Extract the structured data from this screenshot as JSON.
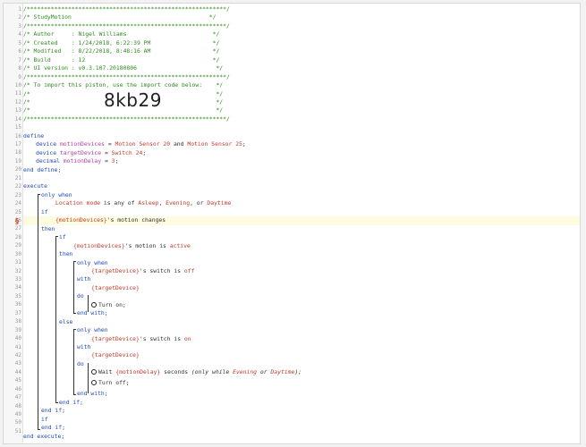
{
  "line_numbers": [
    "1",
    "2",
    "3",
    "4",
    "5",
    "6",
    "7",
    "8",
    "9",
    "10",
    "11",
    "12",
    "13",
    "14",
    "15",
    "16",
    "17",
    "18",
    "19",
    "20",
    "21",
    "22",
    "23",
    "24",
    "25",
    "26",
    "27",
    "28",
    "29",
    "30",
    "31",
    "32",
    "33",
    "34",
    "35",
    "36",
    "37",
    "38",
    "39",
    "40",
    "41",
    "42",
    "43",
    "44",
    "45",
    "46",
    "47",
    "48",
    "49",
    "50",
    "51"
  ],
  "header": {
    "border": "/**********************************************************/",
    "title": "/* StudyMotion                                        */",
    "author": "/* Author     : Nigel Williams                         */",
    "created": "/* Created    : 1/24/2018, 6:22:39 PM                  */",
    "modified": "/* Modified   : 8/22/2018, 8:48:16 AM                  */",
    "build": "/* Build      : 12                                     */",
    "ui_version": "/* UI version : v0.3.107.20180806                       */",
    "import_hint": "/* To import this piston, use the import code below:    */",
    "blank": "/*                                                      */",
    "import_code": "8kb29"
  },
  "code": {
    "define": "define",
    "device_kw": "device",
    "decimal_kw": "decimal",
    "motion_devices": "motionDevices",
    "target_device": "targetDevice",
    "motion_delay": "motionDelay",
    "eq": " = ",
    "sensor20": "Motion Sensor 20",
    "and": " and ",
    "sensor25": "Motion Sensor 25",
    "semicolon": ";",
    "switch24": "Switch 24",
    "three": "3",
    "end_define": "end define;",
    "execute": "execute",
    "only_when": "only when",
    "location_mode": "Location mode",
    "is_any_of": " is any of ",
    "asleep": "Asleep",
    "comma": ", ",
    "evening": "Evening",
    "or_word": ", or ",
    "daytime": "Daytime",
    "if_kw": "if",
    "motion_devices_ref": "{motionDevices}",
    "motion_changes": "'s motion changes",
    "then_kw": "then",
    "motion_is": "'s motion is ",
    "active": "active",
    "target_device_ref": "{targetDevice}",
    "switch_is": "'s switch is ",
    "off": "off",
    "on": "on",
    "with_kw": "with",
    "do_kw": "do",
    "turn_on": "Turn on;",
    "end_with": "end with;",
    "else_kw": "else",
    "wait": "Wait ",
    "motion_delay_ref": "{motionDelay}",
    "seconds": " seconds ",
    "only_while_open": "(only while ",
    "or_plain": " or ",
    "close_paren": ");",
    "turn_off": "Turn off;",
    "end_if": "end if;",
    "end_execute": "end execute;"
  },
  "colors": {
    "comment": "#2e8b1e",
    "keyword": "#1f49b8",
    "variable": "#b03fa3",
    "value": "#c4392b",
    "marker": "#d04a1e"
  }
}
